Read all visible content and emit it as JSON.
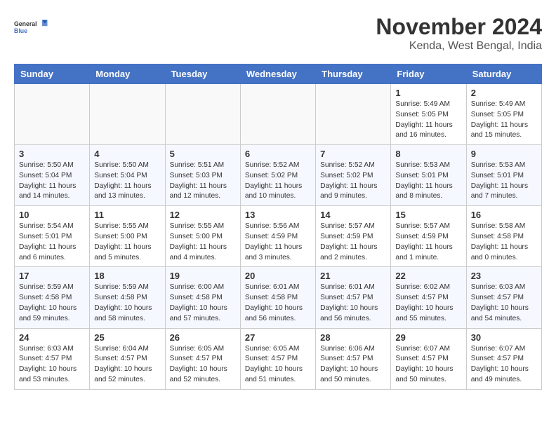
{
  "header": {
    "logo_general": "General",
    "logo_blue": "Blue",
    "month_title": "November 2024",
    "location": "Kenda, West Bengal, India"
  },
  "weekdays": [
    "Sunday",
    "Monday",
    "Tuesday",
    "Wednesday",
    "Thursday",
    "Friday",
    "Saturday"
  ],
  "weeks": [
    [
      {
        "day": "",
        "info": ""
      },
      {
        "day": "",
        "info": ""
      },
      {
        "day": "",
        "info": ""
      },
      {
        "day": "",
        "info": ""
      },
      {
        "day": "",
        "info": ""
      },
      {
        "day": "1",
        "info": "Sunrise: 5:49 AM\nSunset: 5:05 PM\nDaylight: 11 hours\nand 16 minutes."
      },
      {
        "day": "2",
        "info": "Sunrise: 5:49 AM\nSunset: 5:05 PM\nDaylight: 11 hours\nand 15 minutes."
      }
    ],
    [
      {
        "day": "3",
        "info": "Sunrise: 5:50 AM\nSunset: 5:04 PM\nDaylight: 11 hours\nand 14 minutes."
      },
      {
        "day": "4",
        "info": "Sunrise: 5:50 AM\nSunset: 5:04 PM\nDaylight: 11 hours\nand 13 minutes."
      },
      {
        "day": "5",
        "info": "Sunrise: 5:51 AM\nSunset: 5:03 PM\nDaylight: 11 hours\nand 12 minutes."
      },
      {
        "day": "6",
        "info": "Sunrise: 5:52 AM\nSunset: 5:02 PM\nDaylight: 11 hours\nand 10 minutes."
      },
      {
        "day": "7",
        "info": "Sunrise: 5:52 AM\nSunset: 5:02 PM\nDaylight: 11 hours\nand 9 minutes."
      },
      {
        "day": "8",
        "info": "Sunrise: 5:53 AM\nSunset: 5:01 PM\nDaylight: 11 hours\nand 8 minutes."
      },
      {
        "day": "9",
        "info": "Sunrise: 5:53 AM\nSunset: 5:01 PM\nDaylight: 11 hours\nand 7 minutes."
      }
    ],
    [
      {
        "day": "10",
        "info": "Sunrise: 5:54 AM\nSunset: 5:01 PM\nDaylight: 11 hours\nand 6 minutes."
      },
      {
        "day": "11",
        "info": "Sunrise: 5:55 AM\nSunset: 5:00 PM\nDaylight: 11 hours\nand 5 minutes."
      },
      {
        "day": "12",
        "info": "Sunrise: 5:55 AM\nSunset: 5:00 PM\nDaylight: 11 hours\nand 4 minutes."
      },
      {
        "day": "13",
        "info": "Sunrise: 5:56 AM\nSunset: 4:59 PM\nDaylight: 11 hours\nand 3 minutes."
      },
      {
        "day": "14",
        "info": "Sunrise: 5:57 AM\nSunset: 4:59 PM\nDaylight: 11 hours\nand 2 minutes."
      },
      {
        "day": "15",
        "info": "Sunrise: 5:57 AM\nSunset: 4:59 PM\nDaylight: 11 hours\nand 1 minute."
      },
      {
        "day": "16",
        "info": "Sunrise: 5:58 AM\nSunset: 4:58 PM\nDaylight: 11 hours\nand 0 minutes."
      }
    ],
    [
      {
        "day": "17",
        "info": "Sunrise: 5:59 AM\nSunset: 4:58 PM\nDaylight: 10 hours\nand 59 minutes."
      },
      {
        "day": "18",
        "info": "Sunrise: 5:59 AM\nSunset: 4:58 PM\nDaylight: 10 hours\nand 58 minutes."
      },
      {
        "day": "19",
        "info": "Sunrise: 6:00 AM\nSunset: 4:58 PM\nDaylight: 10 hours\nand 57 minutes."
      },
      {
        "day": "20",
        "info": "Sunrise: 6:01 AM\nSunset: 4:58 PM\nDaylight: 10 hours\nand 56 minutes."
      },
      {
        "day": "21",
        "info": "Sunrise: 6:01 AM\nSunset: 4:57 PM\nDaylight: 10 hours\nand 56 minutes."
      },
      {
        "day": "22",
        "info": "Sunrise: 6:02 AM\nSunset: 4:57 PM\nDaylight: 10 hours\nand 55 minutes."
      },
      {
        "day": "23",
        "info": "Sunrise: 6:03 AM\nSunset: 4:57 PM\nDaylight: 10 hours\nand 54 minutes."
      }
    ],
    [
      {
        "day": "24",
        "info": "Sunrise: 6:03 AM\nSunset: 4:57 PM\nDaylight: 10 hours\nand 53 minutes."
      },
      {
        "day": "25",
        "info": "Sunrise: 6:04 AM\nSunset: 4:57 PM\nDaylight: 10 hours\nand 52 minutes."
      },
      {
        "day": "26",
        "info": "Sunrise: 6:05 AM\nSunset: 4:57 PM\nDaylight: 10 hours\nand 52 minutes."
      },
      {
        "day": "27",
        "info": "Sunrise: 6:05 AM\nSunset: 4:57 PM\nDaylight: 10 hours\nand 51 minutes."
      },
      {
        "day": "28",
        "info": "Sunrise: 6:06 AM\nSunset: 4:57 PM\nDaylight: 10 hours\nand 50 minutes."
      },
      {
        "day": "29",
        "info": "Sunrise: 6:07 AM\nSunset: 4:57 PM\nDaylight: 10 hours\nand 50 minutes."
      },
      {
        "day": "30",
        "info": "Sunrise: 6:07 AM\nSunset: 4:57 PM\nDaylight: 10 hours\nand 49 minutes."
      }
    ]
  ]
}
